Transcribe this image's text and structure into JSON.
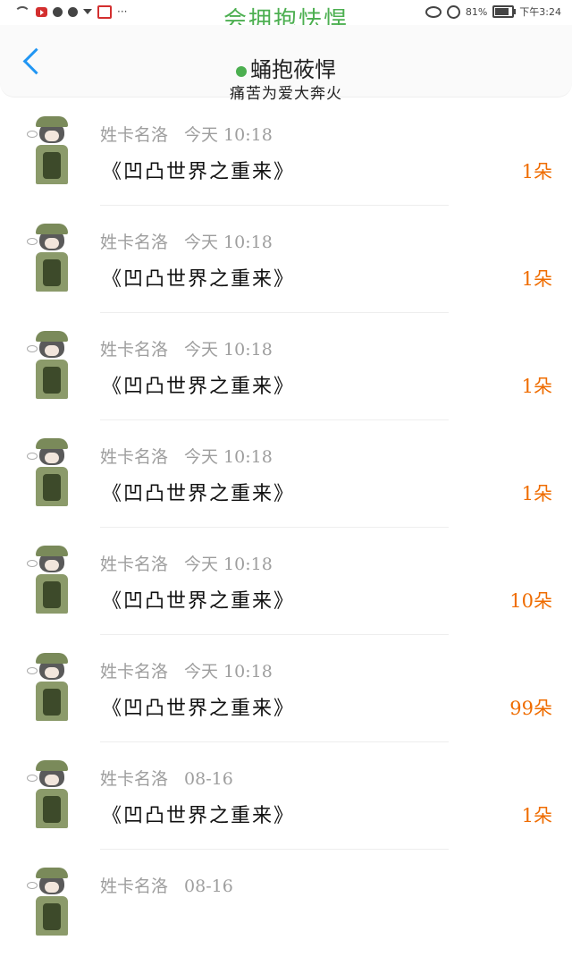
{
  "status_bar": {
    "app_title": "会拥抱怯悍",
    "dots": "···",
    "battery": "81%",
    "battery_fill": 0.81,
    "time": "下午3:24"
  },
  "header": {
    "title": "蛹抱莜悍",
    "subtitle": "痛苦为爱大奔火"
  },
  "colors": {
    "accent_green": "#4caf50",
    "back_blue": "#2196f3",
    "amount_orange": "#ef6c00"
  },
  "gifts": [
    {
      "user": "姓卡名洛",
      "time": "今天 10:18",
      "title": "《凹凸世界之重来》",
      "amount": "1朵"
    },
    {
      "user": "姓卡名洛",
      "time": "今天 10:18",
      "title": "《凹凸世界之重来》",
      "amount": "1朵"
    },
    {
      "user": "姓卡名洛",
      "time": "今天 10:18",
      "title": "《凹凸世界之重来》",
      "amount": "1朵"
    },
    {
      "user": "姓卡名洛",
      "time": "今天 10:18",
      "title": "《凹凸世界之重来》",
      "amount": "1朵"
    },
    {
      "user": "姓卡名洛",
      "time": "今天 10:18",
      "title": "《凹凸世界之重来》",
      "amount": "10朵"
    },
    {
      "user": "姓卡名洛",
      "time": "今天 10:18",
      "title": "《凹凸世界之重来》",
      "amount": "99朵"
    },
    {
      "user": "姓卡名洛",
      "time": "08-16",
      "title": "《凹凸世界之重来》",
      "amount": "1朵"
    },
    {
      "user": "姓卡名洛",
      "time": "08-16",
      "title": "",
      "amount": ""
    }
  ]
}
